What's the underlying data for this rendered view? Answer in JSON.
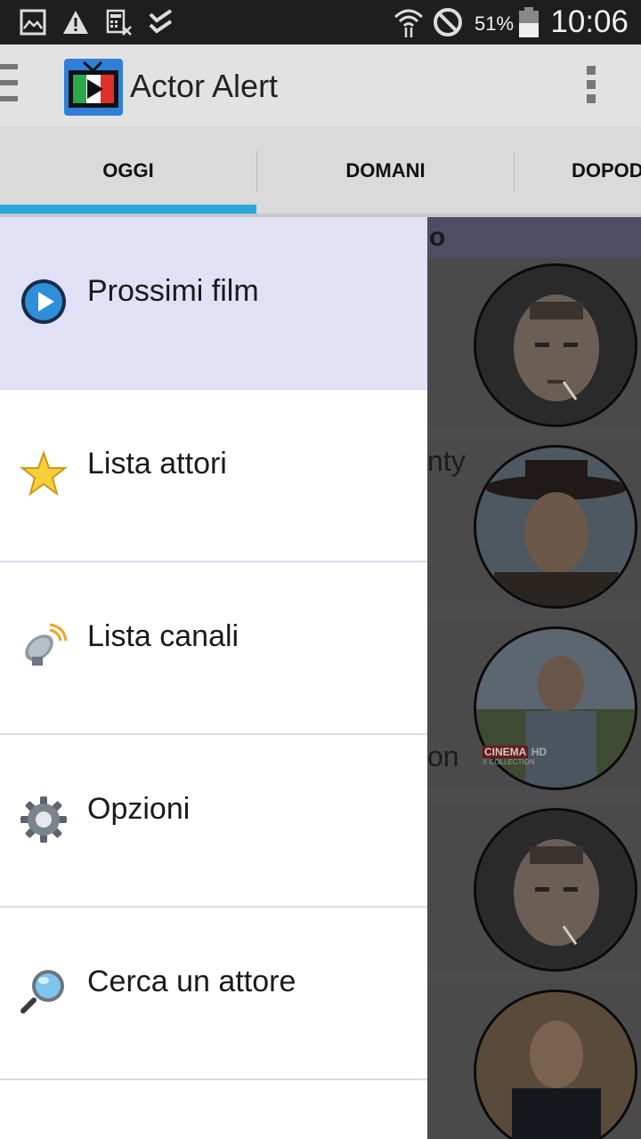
{
  "status_bar": {
    "battery_percent": "51%",
    "time": "10:06"
  },
  "app_bar": {
    "title": "Actor Alert"
  },
  "tabs": [
    {
      "label": "OGGI",
      "selected": true
    },
    {
      "label": "DOMANI",
      "selected": false
    },
    {
      "label": "DOPOD",
      "selected": false
    }
  ],
  "background_list": {
    "header_fragment": "o",
    "card_fragments": [
      "nty",
      "on"
    ],
    "channel_badge": "CINEMA",
    "channel_badge_hd": "HD",
    "channel_subtitle": "X COLLECTION"
  },
  "drawer": {
    "items": [
      {
        "label": "Prossimi film",
        "icon": "play-circle-icon",
        "active": true
      },
      {
        "label": "Lista attori",
        "icon": "star-icon",
        "active": false
      },
      {
        "label": "Lista canali",
        "icon": "satellite-dish-icon",
        "active": false
      },
      {
        "label": "Opzioni",
        "icon": "gear-icon",
        "active": false
      },
      {
        "label": "Cerca un attore",
        "icon": "magnifier-icon",
        "active": false
      }
    ]
  },
  "colors": {
    "tab_indicator": "#2aa7de",
    "active_item_bg": "#e0e1f5",
    "app_bar_bg": "#e2e2e2",
    "status_bar_bg": "#1e1e1e"
  }
}
